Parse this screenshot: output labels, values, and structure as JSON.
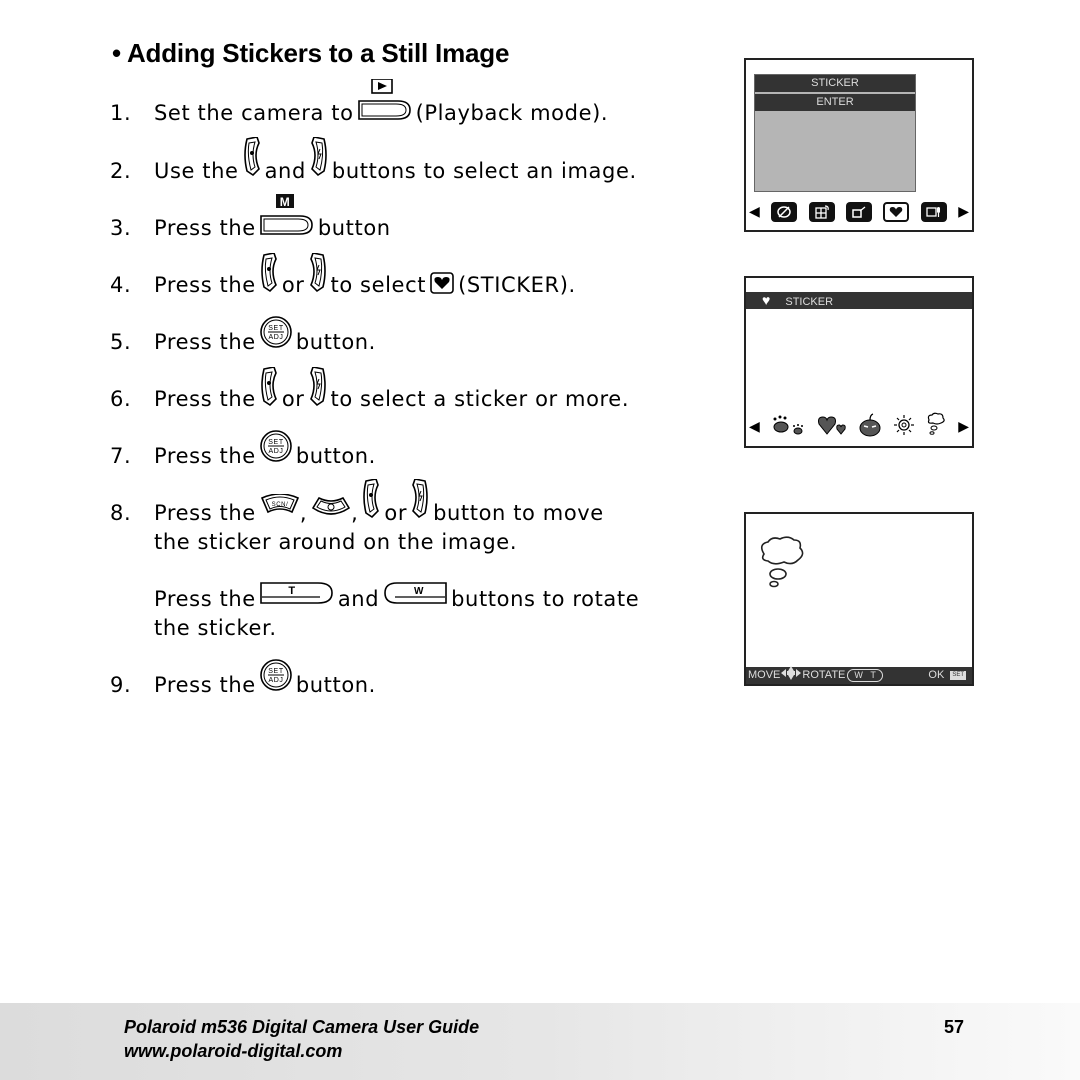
{
  "title": "• Adding Stickers to a Still Image",
  "steps": [
    {
      "num": "1.",
      "parts": [
        "Set the camera to",
        "(Playback mode)."
      ]
    },
    {
      "num": "2.",
      "parts": [
        "Use the",
        "and",
        "buttons to select an image."
      ]
    },
    {
      "num": "3.",
      "parts": [
        "Press the",
        "button"
      ]
    },
    {
      "num": "4.",
      "parts": [
        "Press the",
        "or",
        "to select",
        "(STICKER)."
      ]
    },
    {
      "num": "5.",
      "parts": [
        "Press the",
        "button."
      ]
    },
    {
      "num": "6.",
      "parts": [
        "Press the",
        "or",
        "to select a sticker or more."
      ]
    },
    {
      "num": "7.",
      "parts": [
        "Press the",
        "button."
      ]
    },
    {
      "num": "8.",
      "parts": [
        "Press the",
        ",",
        ",",
        "or",
        "button to move"
      ],
      "cont": "the sticker around on the image."
    },
    {
      "num": "",
      "parts": [
        "Press the",
        "and",
        "buttons to rotate"
      ],
      "cont": "the sticker."
    },
    {
      "num": "9.",
      "parts": [
        "Press the",
        "button."
      ]
    }
  ],
  "icons": {
    "playback_label": "▶",
    "menu_label": "M",
    "set_top": "SET",
    "set_bottom": "ADJ",
    "tele_label": "T",
    "wide_label": "W",
    "scn_label": "SCN/",
    "heart": "♥"
  },
  "screen1": {
    "menu_items": [
      "STICKER",
      "ENTER"
    ],
    "left_arrow": "◀",
    "right_arrow": "▶",
    "icons": [
      "color-effect",
      "frame-rotate",
      "resize",
      "sticker-heart",
      "voice-memo"
    ],
    "selected_index": 3
  },
  "screen2": {
    "header_icon": "♥",
    "header_label": "STICKER",
    "left_arrow": "◀",
    "right_arrow": "▶",
    "stickers": [
      "paws",
      "hearts",
      "pumpkin",
      "sun",
      "thought-bubble"
    ]
  },
  "screen3": {
    "move_label": "MOVE",
    "move_arrows": "◂⬍▸",
    "rotate_label": "ROTATE",
    "rotate_w": "W",
    "rotate_t": "T",
    "ok_label": "OK",
    "set_label": "SET"
  },
  "footer": {
    "guide_title": "Polaroid m536 Digital Camera User Guide",
    "website": "www.polaroid-digital.com",
    "page_number": "57"
  }
}
